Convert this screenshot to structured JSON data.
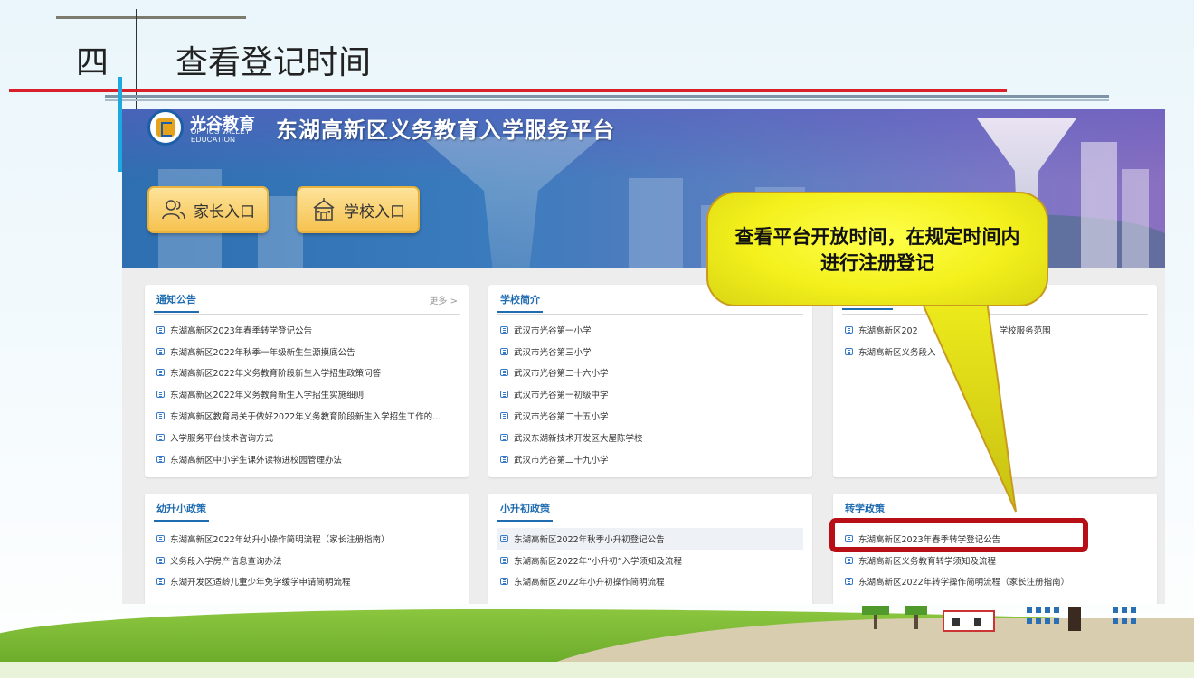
{
  "slide": {
    "number": "四",
    "title": "查看登记时间"
  },
  "platform": {
    "logo_name": "光谷教育",
    "logo_sub_line1": "OPTICS VALLEY",
    "logo_sub_line2": "EDUCATION",
    "title": "东湖高新区义务教育入学服务平台",
    "parent_entry": "家长入口",
    "school_entry": "学校入口"
  },
  "panels": {
    "notice": {
      "title": "通知公告",
      "more": "更多 >",
      "items": [
        "东湖高新区2023年春季转学登记公告",
        "东湖高新区2022年秋季一年级新生生源摸底公告",
        "东湖高新区2022年义务教育阶段新生入学招生政策问答",
        "东湖高新区2022年义务教育新生入学招生实施细则",
        "东湖高新区教育局关于做好2022年义务教育阶段新生入学招生工作的...",
        "入学服务平台技术咨询方式",
        "东湖高新区中小学生课外读物进校园管理办法"
      ]
    },
    "schools": {
      "title": "学校简介",
      "items": [
        "武汉市光谷第一小学",
        "武汉市光谷第三小学",
        "武汉市光谷第二十六小学",
        "武汉市光谷第一初级中学",
        "武汉市光谷第二十五小学",
        "武汉东湖新技术开发区大屋陈学校",
        "武汉市光谷第二十九小学"
      ]
    },
    "scope": {
      "items": [
        "东湖高新区202",
        "学校服务范围",
        "东湖高新区义务段入"
      ]
    },
    "kindergarten": {
      "title": "幼升小政策",
      "items": [
        "东湖高新区2022年幼升小操作简明流程（家长注册指南）",
        "义务段入学房产信息查询办法",
        "东湖开发区适龄儿童少年免学缓学申请简明流程"
      ]
    },
    "primary": {
      "title": "小升初政策",
      "items": [
        "东湖高新区2022年秋季小升初登记公告",
        "东湖高新区2022年“小升初”入学须知及流程",
        "东湖高新区2022年小升初操作简明流程"
      ]
    },
    "transfer": {
      "title": "转学政策",
      "items": [
        "东湖高新区2023年春季转学登记公告",
        "东湖高新区义务教育转学须知及流程",
        "东湖高新区2022年转学操作简明流程（家长注册指南）"
      ]
    }
  },
  "callout": {
    "text": "查看平台开放时间，在规定时间内进行注册登记"
  },
  "colors": {
    "accent_blue": "#1f6cb1",
    "callout_yellow": "#f3f01c",
    "highlight_red": "#b80f16",
    "title_red_line": "#d9202a"
  }
}
